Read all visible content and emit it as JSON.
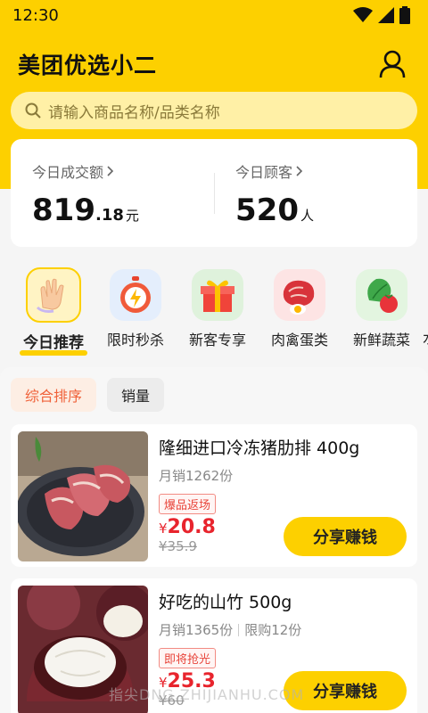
{
  "status_bar": {
    "time": "12:30"
  },
  "header": {
    "title": "美团优选小二"
  },
  "search": {
    "placeholder": "请输入商品名称/品类名称"
  },
  "stats": {
    "turnover": {
      "label": "今日成交额",
      "integer": "819",
      "decimal": ".18",
      "unit": "元"
    },
    "customers": {
      "label": "今日顾客",
      "value": "520",
      "unit": "人"
    }
  },
  "categories": [
    {
      "label": "今日推荐",
      "icon": "clapping-hands-icon",
      "active": true
    },
    {
      "label": "限时秒杀",
      "icon": "alarm-clock-icon",
      "active": false
    },
    {
      "label": "新客专享",
      "icon": "gift-box-icon",
      "active": false
    },
    {
      "label": "肉禽蛋类",
      "icon": "meat-egg-icon",
      "active": false
    },
    {
      "label": "新鲜蔬菜",
      "icon": "vegetable-icon",
      "active": false
    }
  ],
  "sort": {
    "options": [
      "综合排序",
      "销量"
    ],
    "selected": "综合排序"
  },
  "products": [
    {
      "name": "隆细进口冷冻猪肋排 400g",
      "sales": "月销1262份",
      "limit": "",
      "tag": "爆品返场",
      "currency": "¥",
      "price": "20.8",
      "original_price": "¥35.9",
      "button": "分享赚钱"
    },
    {
      "name": "好吃的山竹 500g",
      "sales": "月销1365份",
      "limit": "限购12份",
      "tag": "即将抢光",
      "currency": "¥",
      "price": "25.3",
      "original_price": "¥60",
      "button": "分享赚钱"
    }
  ],
  "colors": {
    "brand_yellow": "#fdd000",
    "price_red": "#e8242d",
    "sort_active": "#f0623a"
  },
  "watermark": "指尖DNG.ZHIJIANHU.COM"
}
